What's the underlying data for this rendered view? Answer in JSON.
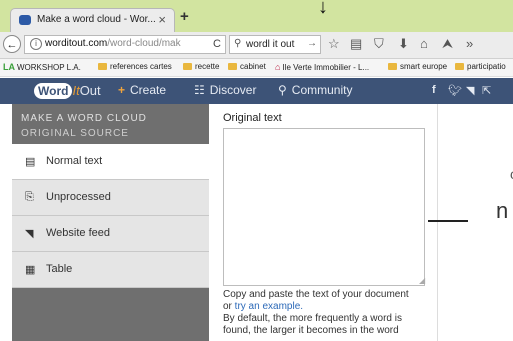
{
  "browser": {
    "tab_title": "Make a word cloud - Wor...",
    "tab_close": "×",
    "new_tab": "+",
    "back": "←",
    "url_domain": "worditout.com",
    "url_path": "/word-cloud/mak",
    "reload": "C",
    "search_query": "wordl it out",
    "search_go": "→",
    "toolbar_icons": [
      "☆",
      "▤",
      "⛉",
      "⬇",
      "⌂",
      "⮝",
      "»"
    ]
  },
  "bookmarks": [
    {
      "label": "WORKSHOP L.A.",
      "icon": "la-logo-icon"
    },
    {
      "label": "references cartes",
      "icon": "folder-icon"
    },
    {
      "label": "recette",
      "icon": "folder-icon"
    },
    {
      "label": "cabinet",
      "icon": "folder-icon"
    },
    {
      "label": "Ile Verte Immobilier - L...",
      "icon": "house-icon"
    },
    {
      "label": "smart europe",
      "icon": "folder-icon"
    },
    {
      "label": "participatio",
      "icon": "folder-icon"
    }
  ],
  "site": {
    "logo_word": "Word",
    "logo_it": "It",
    "logo_out": "Out",
    "nav": [
      {
        "label": "Create",
        "icon": "+"
      },
      {
        "label": "Discover",
        "icon": "☷"
      },
      {
        "label": "Community",
        "icon": "⚲"
      }
    ],
    "social_icons": [
      "f",
      "t",
      "rss",
      "share"
    ]
  },
  "sidebar": {
    "heading_line1": "MAKE A WORD CLOUD",
    "heading_line2": "ORIGINAL SOURCE",
    "items": [
      {
        "label": "Normal text",
        "icon": "▤",
        "active": true
      },
      {
        "label": "Unprocessed",
        "icon": "⎘",
        "active": false
      },
      {
        "label": "Website feed",
        "icon": "◥",
        "active": false
      },
      {
        "label": "Table",
        "icon": "▦",
        "active": false
      }
    ]
  },
  "main": {
    "original_text_label": "Original text",
    "textarea_value": "",
    "help_line1": "Copy and paste the text of your document",
    "help_or": "or ",
    "help_link": "try an example.",
    "help_line3": "By default, the more frequently a word is",
    "help_line4": "found, the larger it becomes in the word"
  },
  "preview": {
    "fragment1": "c",
    "fragment2": "n"
  },
  "colors": {
    "header_bg": "#3d5377",
    "sidebar_bg": "#6f6f6f",
    "logo_accent": "#e59c37",
    "tabbar_bg": "#d2e4a0"
  }
}
